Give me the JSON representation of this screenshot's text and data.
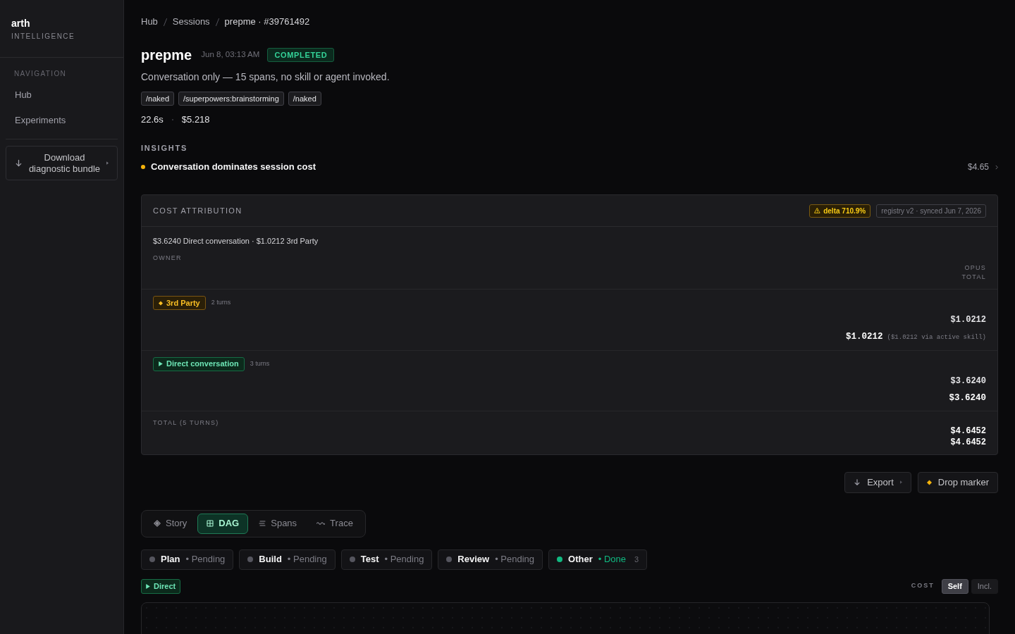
{
  "sidebar": {
    "brand": "arth",
    "tagline": "INTELLIGENCE",
    "section": "NAVIGATION",
    "items": [
      {
        "label": "Hub"
      },
      {
        "label": "Experiments"
      }
    ],
    "download": "Download diagnostic bundle"
  },
  "breadcrumb": [
    "Hub",
    "Sessions",
    "prepme · #39761492"
  ],
  "session": {
    "title": "prepme",
    "date": "Jun 8, 03:13 AM",
    "status": "COMPLETED",
    "description": "Conversation only — 15 spans, no skill or agent invoked.",
    "tags": [
      "/naked",
      "/superpowers:brainstorming",
      "/naked"
    ],
    "stats": [
      "22.6s",
      "$5.218"
    ]
  },
  "insights": {
    "heading": "INSIGHTS",
    "items": [
      {
        "color": "#f5b30b",
        "text": "Conversation dominates session cost",
        "value": "$4.65"
      }
    ]
  },
  "cost_attribution": {
    "title": "COST ATTRIBUTION",
    "badges": [
      {
        "kind": "warning",
        "text": "delta 710.9%"
      },
      {
        "kind": "info",
        "text": "registry v2 · synced Jun 7, 2026"
      }
    ],
    "summary": "$3.6240 Direct conversation · $1.0212 3rd Party",
    "owner_label": "OWNER",
    "columns": [
      "OPUS",
      "TOTAL"
    ],
    "rows": [
      {
        "kind": "third_party",
        "owner": "3rd Party",
        "turns": "2 turns",
        "opus": "$1.0212",
        "total": "$1.0212",
        "note": "($1.0212 via active skill)"
      },
      {
        "kind": "direct",
        "owner": "Direct conversation",
        "turns": "3 turns",
        "opus": "$3.6240",
        "total": "$3.6240"
      }
    ],
    "total": {
      "label": "TOTAL (5 TURNS)",
      "opus": "$4.6452",
      "total": "$4.6452"
    }
  },
  "actions": [
    {
      "kind": "export",
      "label": "Export"
    },
    {
      "kind": "marker",
      "label": "Drop marker"
    }
  ],
  "view_tabs": [
    {
      "label": "Story",
      "selected": false
    },
    {
      "label": "DAG",
      "selected": true
    },
    {
      "label": "Spans",
      "selected": false
    },
    {
      "label": "Trace",
      "selected": false
    }
  ],
  "phases": [
    {
      "name": "Plan",
      "status": "• Pending",
      "done": false
    },
    {
      "name": "Build",
      "status": "• Pending",
      "done": false
    },
    {
      "name": "Test",
      "status": "• Pending",
      "done": false
    },
    {
      "name": "Review",
      "status": "• Pending",
      "done": false
    },
    {
      "name": "Other",
      "status": "• Done",
      "done": true,
      "count": "3"
    }
  ],
  "filter": {
    "kind": "direct",
    "label": "Direct"
  },
  "cost_toggle": {
    "label": "COST",
    "options": [
      {
        "label": "Self",
        "selected": true
      },
      {
        "label": "Incl.",
        "selected": false
      }
    ]
  }
}
